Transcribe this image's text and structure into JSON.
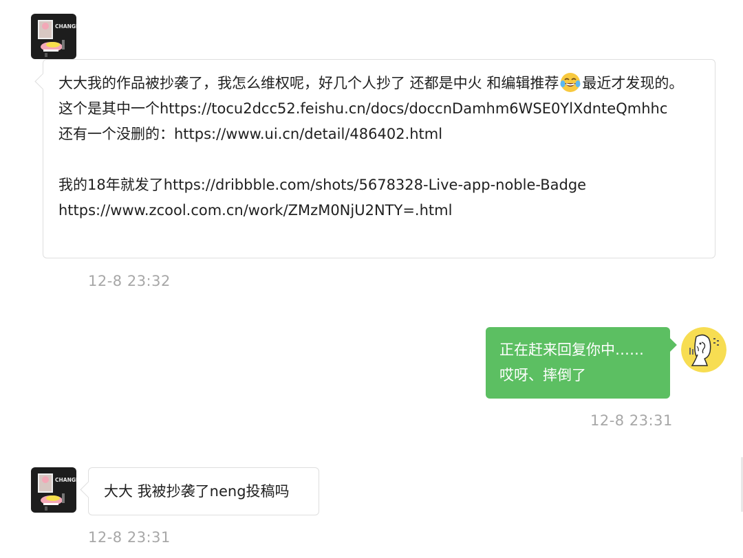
{
  "messages": [
    {
      "direction": "incoming",
      "avatar_text": "CHANGE",
      "lines": [
        "大大我的作品被抄袭了，我怎么维权呢，好几个人抄了 还都是中火 和编辑推荐",
        "最近才发现的。",
        "这个是其中一个https://tocu2dcc52.feishu.cn/docs/doccnDamhm6WSE0YlXdnteQmhhc",
        "还有一个没删的：https://www.ui.cn/detail/486402.html",
        "",
        "我的18年就发了https://dribbble.com/shots/5678328-Live-app-noble-Badge",
        "https://www.zcool.com.cn/work/ZMzM0NjU2NTY=.html"
      ],
      "emoji": "face-with-tears-of-joy",
      "time": "12-8 23:32"
    },
    {
      "direction": "outgoing",
      "lines": [
        "正在赶来回复你中……",
        "哎呀、摔倒了"
      ],
      "time": "12-8 23:31"
    },
    {
      "direction": "incoming",
      "avatar_text": "CHANGE",
      "lines": [
        "大大 我被抄袭了neng投稿吗"
      ],
      "time": "12-8 23:31"
    }
  ],
  "colors": {
    "outgoing_bubble": "#5cbf62",
    "incoming_border": "#dedede",
    "timestamp": "#a7a7a7",
    "avatar_bg": "#1d1d1d",
    "my_avatar_bg": "#f7dd52"
  }
}
